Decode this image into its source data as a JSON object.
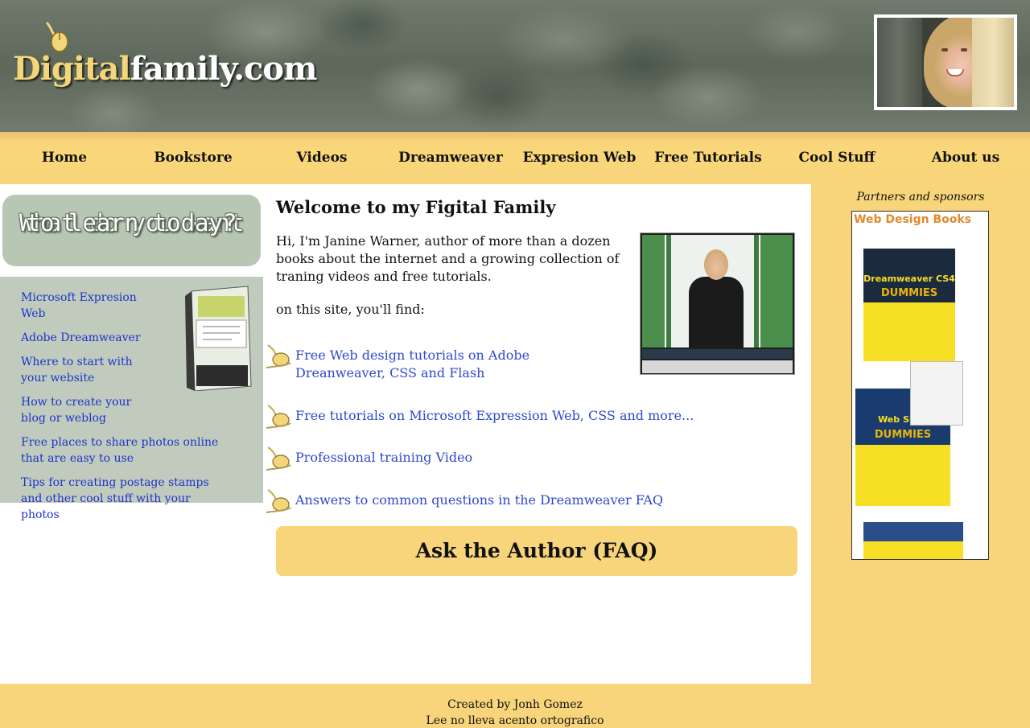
{
  "header": {
    "logo": {
      "part1": "Digital",
      "part2": "family.com"
    }
  },
  "nav": {
    "items": [
      "Home",
      "Bookstore",
      "Videos",
      "Dreamweaver",
      "Expresion Web",
      "Free Tutorials",
      "Cool Stuff",
      "About us"
    ]
  },
  "sidebar": {
    "banner": {
      "line1": "What do you want",
      "line2": "to learn today?"
    },
    "links": [
      "Microsoft Expresion Web",
      "Adobe Dreamweaver",
      "Where to start with your website",
      "How to create your blog or weblog",
      "Free places to share photos online that are easy to use",
      "Tips for creating postage stamps and other cool stuff with your photos"
    ]
  },
  "main": {
    "title": "Welcome to my Figital Family",
    "intro": "Hi, I'm Janine Warner, author of more than a dozen books about the internet and a growing collection of traning videos and free tutorials.",
    "find": "on this site, you'll find:",
    "bullets": [
      "Free Web design tutorials on Adobe Dreanweaver, CSS and Flash",
      "Free tutorials on Microsoft Expression Web, CSS and more...",
      "Professional training Video",
      "Answers to common questions in the Dreamweaver FAQ"
    ],
    "ask_button": "Ask the Author (FAQ)"
  },
  "right": {
    "partners": "Partners and sponsors",
    "books_title": "Web Design Books",
    "book1": "Dreamweaver CS4",
    "book2": "Web Sites",
    "dummies": "DUMMIES"
  },
  "footer": {
    "line1": "Created by Jonh Gomez",
    "line2": "Lee no lleva acento ortografico"
  },
  "colors": {
    "nav_bg": "#f8d57a",
    "sidebar_bg": "#c0cbbd",
    "link": "#2e49cf",
    "logo_gold": "#f3d57a"
  }
}
